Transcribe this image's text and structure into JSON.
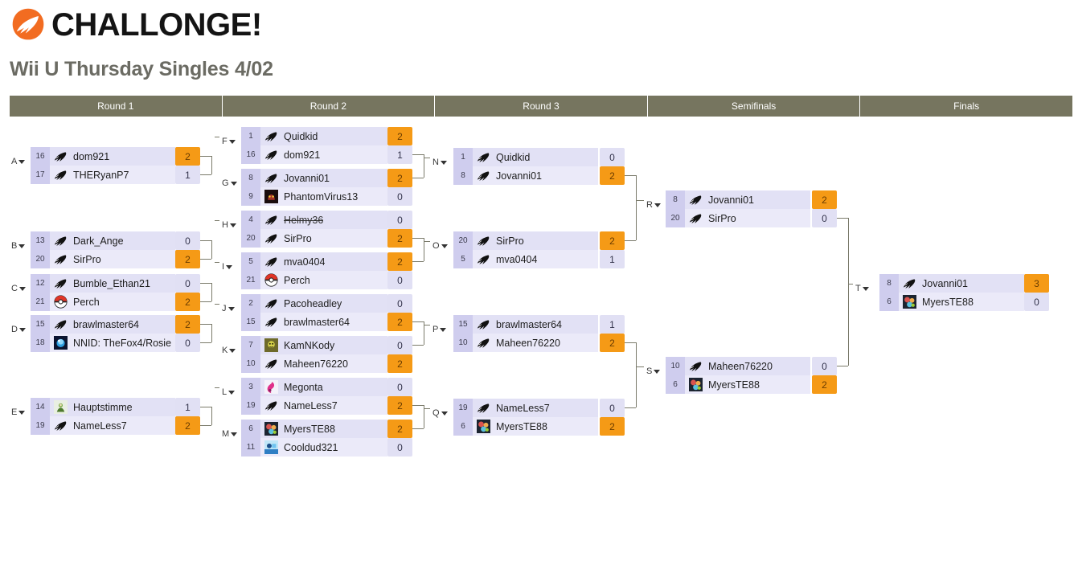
{
  "brand": {
    "name": "CHALLONGE!",
    "logo_icon": "challonge-flame-icon",
    "logo_color": "#f26c21"
  },
  "title": "Wii U Thursday Singles 4/02",
  "theme": {
    "header_bar": "#76755f",
    "winner_score": "#f59a16",
    "loser_score": "#e1e0f4",
    "row_bg": "#e2e1f5",
    "seed_bg": "#cfcdee"
  },
  "rounds": [
    {
      "label": "Round 1"
    },
    {
      "label": "Round 2"
    },
    {
      "label": "Round 3"
    },
    {
      "label": "Semifinals"
    },
    {
      "label": "Finals"
    }
  ],
  "matches": [
    {
      "id": "A",
      "round": 1,
      "players": [
        {
          "seed": "16",
          "name": "dom921",
          "avatar": "challonge",
          "score": "2",
          "winner": true
        },
        {
          "seed": "17",
          "name": "THERyanP7",
          "avatar": "challonge",
          "score": "1",
          "winner": false
        }
      ]
    },
    {
      "id": "B",
      "round": 1,
      "players": [
        {
          "seed": "13",
          "name": "Dark_Ange",
          "avatar": "challonge",
          "score": "0",
          "winner": false
        },
        {
          "seed": "20",
          "name": "SirPro",
          "avatar": "challonge",
          "score": "2",
          "winner": true
        }
      ]
    },
    {
      "id": "C",
      "round": 1,
      "players": [
        {
          "seed": "12",
          "name": "Bumble_Ethan21",
          "avatar": "challonge",
          "score": "0",
          "winner": false
        },
        {
          "seed": "21",
          "name": "Perch",
          "avatar": "pokeball",
          "score": "2",
          "winner": true
        }
      ]
    },
    {
      "id": "D",
      "round": 1,
      "players": [
        {
          "seed": "15",
          "name": "brawlmaster64",
          "avatar": "challonge",
          "score": "2",
          "winner": true
        },
        {
          "seed": "18",
          "name": "NNID: TheFox4/Rosie",
          "avatar": "blue-orb",
          "score": "0",
          "winner": false
        }
      ]
    },
    {
      "id": "E",
      "round": 1,
      "players": [
        {
          "seed": "14",
          "name": "Hauptstimme",
          "avatar": "pale-green",
          "score": "1",
          "winner": false
        },
        {
          "seed": "19",
          "name": "NameLess7",
          "avatar": "challonge",
          "score": "2",
          "winner": true
        }
      ]
    },
    {
      "id": "F",
      "round": 2,
      "players": [
        {
          "seed": "1",
          "name": "Quidkid",
          "avatar": "challonge",
          "score": "2",
          "winner": true
        },
        {
          "seed": "16",
          "name": "dom921",
          "avatar": "challonge",
          "score": "1",
          "winner": false
        }
      ]
    },
    {
      "id": "G",
      "round": 2,
      "players": [
        {
          "seed": "8",
          "name": "Jovanni01",
          "avatar": "challonge",
          "score": "2",
          "winner": true
        },
        {
          "seed": "9",
          "name": "PhantomVirus13",
          "avatar": "dark-red",
          "score": "0",
          "winner": false
        }
      ]
    },
    {
      "id": "H",
      "round": 2,
      "players": [
        {
          "seed": "4",
          "name": "Helmy36",
          "avatar": "challonge",
          "score": "0",
          "winner": false,
          "forfeit": true
        },
        {
          "seed": "20",
          "name": "SirPro",
          "avatar": "challonge",
          "score": "2",
          "winner": true
        }
      ]
    },
    {
      "id": "I",
      "round": 2,
      "players": [
        {
          "seed": "5",
          "name": "mva0404",
          "avatar": "challonge",
          "score": "2",
          "winner": true
        },
        {
          "seed": "21",
          "name": "Perch",
          "avatar": "pokeball",
          "score": "0",
          "winner": false
        }
      ]
    },
    {
      "id": "J",
      "round": 2,
      "players": [
        {
          "seed": "2",
          "name": "Pacoheadley",
          "avatar": "challonge",
          "score": "0",
          "winner": false
        },
        {
          "seed": "15",
          "name": "brawlmaster64",
          "avatar": "challonge",
          "score": "2",
          "winner": true
        }
      ]
    },
    {
      "id": "K",
      "round": 2,
      "players": [
        {
          "seed": "7",
          "name": "KamNKody",
          "avatar": "olive",
          "score": "0",
          "winner": false
        },
        {
          "seed": "10",
          "name": "Maheen76220",
          "avatar": "challonge",
          "score": "2",
          "winner": true
        }
      ]
    },
    {
      "id": "L",
      "round": 2,
      "players": [
        {
          "seed": "3",
          "name": "Megonta",
          "avatar": "magenta",
          "score": "0",
          "winner": false
        },
        {
          "seed": "19",
          "name": "NameLess7",
          "avatar": "challonge",
          "score": "2",
          "winner": true
        }
      ]
    },
    {
      "id": "M",
      "round": 2,
      "players": [
        {
          "seed": "6",
          "name": "MyersTE88",
          "avatar": "colorful",
          "score": "2",
          "winner": true
        },
        {
          "seed": "11",
          "name": "Cooldud321",
          "avatar": "cyan-blue",
          "score": "0",
          "winner": false
        }
      ]
    },
    {
      "id": "N",
      "round": 3,
      "players": [
        {
          "seed": "1",
          "name": "Quidkid",
          "avatar": "challonge",
          "score": "0",
          "winner": false
        },
        {
          "seed": "8",
          "name": "Jovanni01",
          "avatar": "challonge",
          "score": "2",
          "winner": true
        }
      ]
    },
    {
      "id": "O",
      "round": 3,
      "players": [
        {
          "seed": "20",
          "name": "SirPro",
          "avatar": "challonge",
          "score": "2",
          "winner": true
        },
        {
          "seed": "5",
          "name": "mva0404",
          "avatar": "challonge",
          "score": "1",
          "winner": false
        }
      ]
    },
    {
      "id": "P",
      "round": 3,
      "players": [
        {
          "seed": "15",
          "name": "brawlmaster64",
          "avatar": "challonge",
          "score": "1",
          "winner": false
        },
        {
          "seed": "10",
          "name": "Maheen76220",
          "avatar": "challonge",
          "score": "2",
          "winner": true
        }
      ]
    },
    {
      "id": "Q",
      "round": 3,
      "players": [
        {
          "seed": "19",
          "name": "NameLess7",
          "avatar": "challonge",
          "score": "0",
          "winner": false
        },
        {
          "seed": "6",
          "name": "MyersTE88",
          "avatar": "colorful",
          "score": "2",
          "winner": true
        }
      ]
    },
    {
      "id": "R",
      "round": 4,
      "players": [
        {
          "seed": "8",
          "name": "Jovanni01",
          "avatar": "challonge",
          "score": "2",
          "winner": true
        },
        {
          "seed": "20",
          "name": "SirPro",
          "avatar": "challonge",
          "score": "0",
          "winner": false
        }
      ]
    },
    {
      "id": "S",
      "round": 4,
      "players": [
        {
          "seed": "10",
          "name": "Maheen76220",
          "avatar": "challonge",
          "score": "0",
          "winner": false
        },
        {
          "seed": "6",
          "name": "MyersTE88",
          "avatar": "colorful",
          "score": "2",
          "winner": true
        }
      ]
    },
    {
      "id": "T",
      "round": 5,
      "players": [
        {
          "seed": "8",
          "name": "Jovanni01",
          "avatar": "challonge",
          "score": "3",
          "winner": true
        },
        {
          "seed": "6",
          "name": "MyersTE88",
          "avatar": "colorful",
          "score": "0",
          "winner": false
        }
      ]
    }
  ]
}
